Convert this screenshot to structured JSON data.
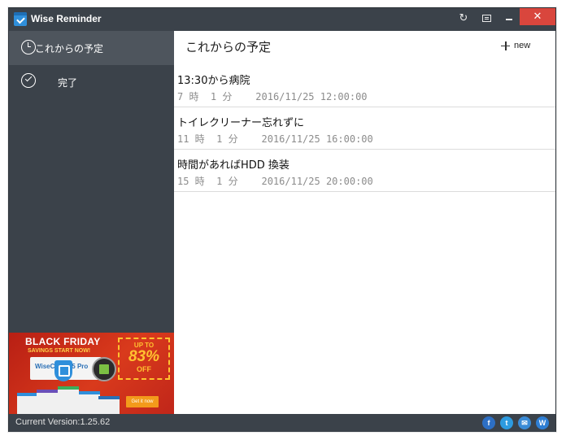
{
  "window": {
    "title": "Wise Reminder",
    "close_glyph": "✕",
    "refresh_glyph": "↻"
  },
  "sidebar": {
    "items": [
      {
        "label": "これからの予定",
        "icon": "clock-icon",
        "active": true
      },
      {
        "label": "完了",
        "icon": "check-circle-icon",
        "active": false
      }
    ]
  },
  "ad": {
    "title": "BLACK FRIDAY",
    "subtitle": "SAVINGS START NOW!",
    "product": "WiseCare365 Pro",
    "upto": "UP TO",
    "percent": "83%",
    "off": "OFF",
    "button": "Get it now"
  },
  "main": {
    "title": "これからの予定",
    "new_label": "new",
    "reminders": [
      {
        "title": "13:30から病院",
        "remaining": "7 時  1 分",
        "datetime": "2016/11/25 12:00:00"
      },
      {
        "title": "トイレクリーナー忘れずに",
        "remaining": "11 時  1 分",
        "datetime": "2016/11/25 16:00:00"
      },
      {
        "title": "時間があればHDD 換装",
        "remaining": "15 時  1 分",
        "datetime": "2016/11/25 20:00:00"
      }
    ]
  },
  "status": {
    "version": "Current Version:1.25.62",
    "social": {
      "facebook": "f",
      "twitter": "t",
      "mail": "✉",
      "wise": "W"
    }
  },
  "colors": {
    "chrome": "#3b424a",
    "active_item": "#4e555d",
    "close": "#d9463d",
    "meta_text": "#8c8c8c"
  }
}
